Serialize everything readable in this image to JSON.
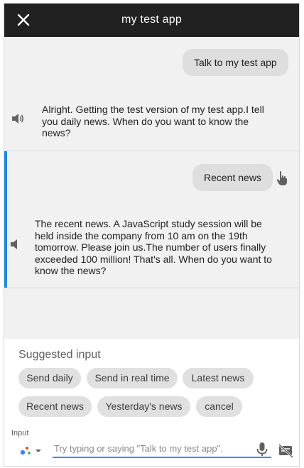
{
  "header": {
    "title": "my test app",
    "close_icon": "close-icon"
  },
  "conversation": {
    "user_message_1": "Talk to my test app",
    "agent_message_1": "Alright. Getting the test version of my test app.I tell you daily news. When do you want to know the news?",
    "user_message_2": "Recent news",
    "agent_message_2": "The recent news. A JavaScript study session will be held inside the company from 10 am on the 19th tomorrow. Please join us.The number of users finally exceeded 100 million! That's all. When do you want to know the news?",
    "selected_accent_color": "#1e88e5"
  },
  "suggestions": {
    "title": "Suggested input",
    "chips": [
      "Send daily",
      "Send in real time",
      "Latest news",
      "Recent news",
      "Yesterday's news",
      "cancel"
    ]
  },
  "input": {
    "label": "Input",
    "placeholder": "Try typing or saying \"Talk to my test app\".",
    "value": "",
    "underline_color": "#4285f4"
  },
  "icons": [
    "close-icon",
    "speaker-icon",
    "touch-icon",
    "assistant-dots-icon",
    "chevron-down-icon",
    "microphone-icon",
    "no-display-icon"
  ]
}
